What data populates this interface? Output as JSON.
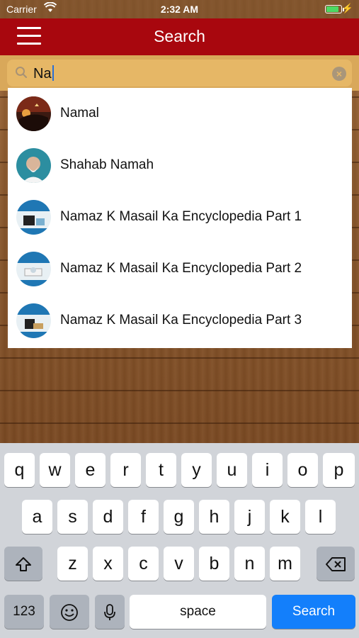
{
  "status_bar": {
    "carrier": "Carrier",
    "time": "2:32 AM",
    "battery_level": 0.75
  },
  "nav": {
    "title": "Search"
  },
  "search": {
    "query": "Na"
  },
  "results": [
    {
      "label": "Namal"
    },
    {
      "label": "Shahab Namah"
    },
    {
      "label": "Namaz K Masail Ka Encyclopedia Part 1"
    },
    {
      "label": "Namaz K Masail Ka Encyclopedia Part 2"
    },
    {
      "label": "Namaz K Masail Ka Encyclopedia Part 3"
    }
  ],
  "keyboard": {
    "row1": [
      "q",
      "w",
      "e",
      "r",
      "t",
      "y",
      "u",
      "i",
      "o",
      "p"
    ],
    "row2": [
      "a",
      "s",
      "d",
      "f",
      "g",
      "h",
      "j",
      "k",
      "l"
    ],
    "row3": [
      "z",
      "x",
      "c",
      "v",
      "b",
      "n",
      "m"
    ],
    "numbers_label": "123",
    "space_label": "space",
    "search_label": "Search"
  },
  "colors": {
    "nav": "#a8070e",
    "search_bar": "#d9a85a",
    "accent": "#137ffb"
  }
}
